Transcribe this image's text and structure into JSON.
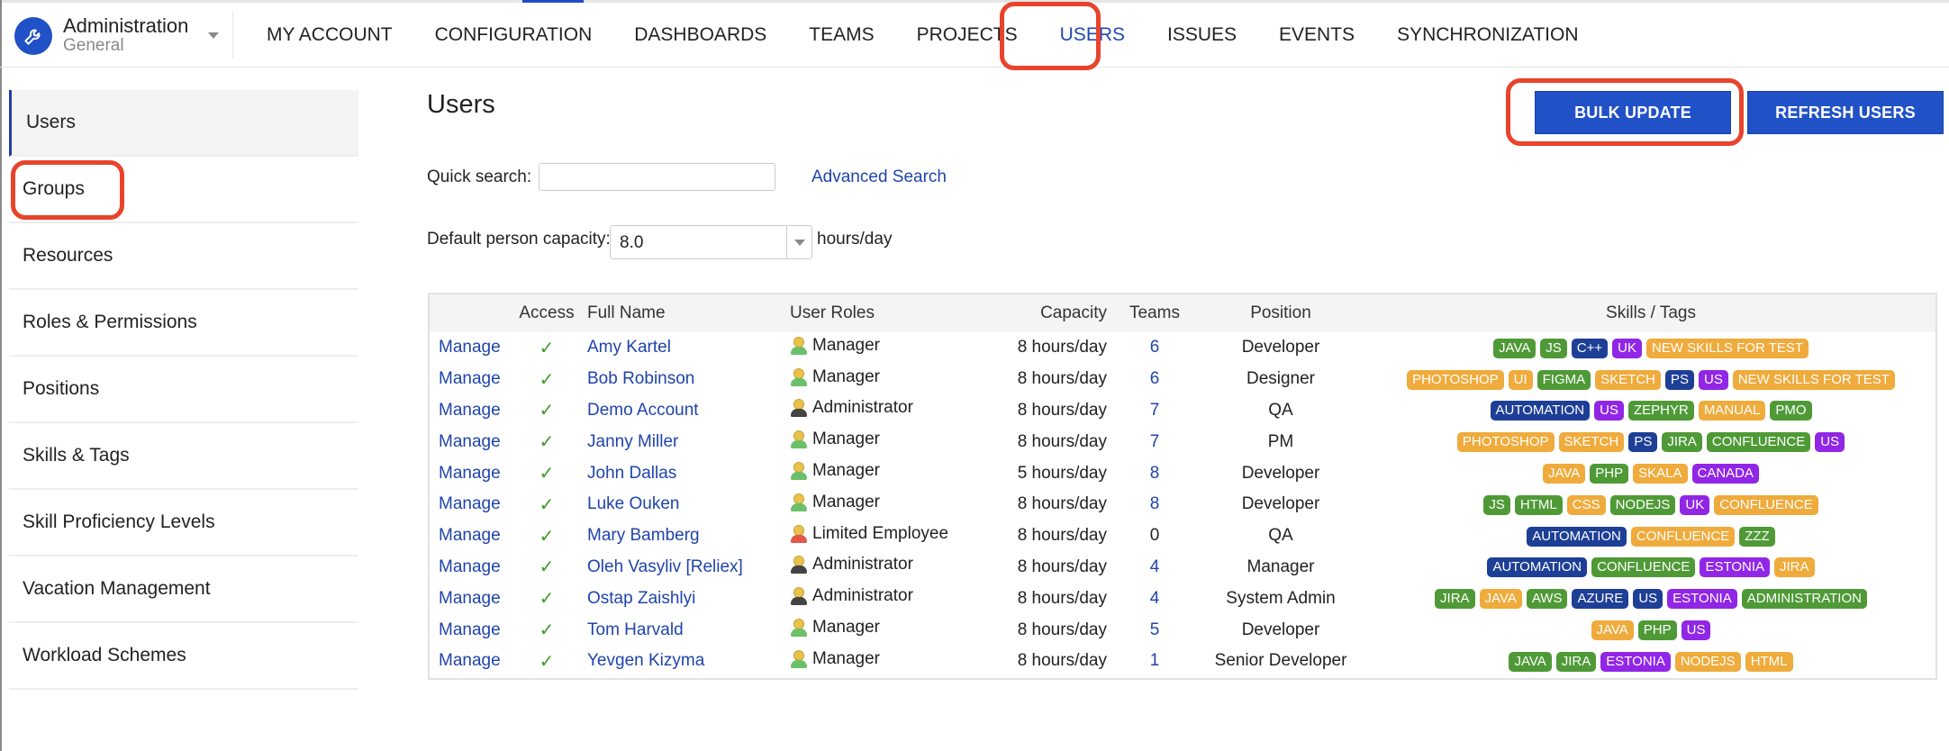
{
  "header": {
    "app_title": "Administration",
    "app_subtitle": "General",
    "nav": [
      {
        "label": "MY ACCOUNT",
        "active": false
      },
      {
        "label": "CONFIGURATION",
        "active": false
      },
      {
        "label": "DASHBOARDS",
        "active": false
      },
      {
        "label": "TEAMS",
        "active": false
      },
      {
        "label": "PROJECTS",
        "active": false
      },
      {
        "label": "USERS",
        "active": true
      },
      {
        "label": "ISSUES",
        "active": false
      },
      {
        "label": "EVENTS",
        "active": false
      },
      {
        "label": "SYNCHRONIZATION",
        "active": false
      }
    ]
  },
  "sidebar": {
    "items": [
      {
        "label": "Users",
        "active": true
      },
      {
        "label": "Groups",
        "active": false
      },
      {
        "label": "Resources",
        "active": false
      },
      {
        "label": "Roles & Permissions",
        "active": false
      },
      {
        "label": "Positions",
        "active": false
      },
      {
        "label": "Skills & Tags",
        "active": false
      },
      {
        "label": "Skill Proficiency Levels",
        "active": false
      },
      {
        "label": "Vacation Management",
        "active": false
      },
      {
        "label": "Workload Schemes",
        "active": false
      }
    ]
  },
  "main": {
    "title": "Users",
    "bulk_update_label": "BULK UPDATE",
    "refresh_users_label": "REFRESH USERS",
    "quick_search_label": "Quick search:",
    "quick_search_value": "",
    "advanced_search_label": "Advanced Search",
    "capacity_label": "Default person capacity:",
    "capacity_value": "8.0",
    "capacity_unit": "hours/day"
  },
  "colors": {
    "accent": "#2151c6",
    "link": "#1f44aa",
    "highlight": "#e8432b",
    "tag_green": "#4f9a37",
    "tag_orange": "#efab3c",
    "tag_navy": "#1e3f96",
    "tag_purple": "#9126e6",
    "role_manager": "#6cc06a",
    "role_admin": "#444444",
    "role_limited": "#e2584a"
  },
  "table": {
    "columns": [
      "",
      "Access",
      "Full Name",
      "User Roles",
      "Capacity",
      "Teams",
      "Position",
      "Skills / Tags"
    ],
    "manage_label": "Manage",
    "access_icon": "✓",
    "rows": [
      {
        "name": "Amy Kartel",
        "role": "Manager",
        "role_type": "manager",
        "capacity": "8 hours/day",
        "teams": "6",
        "position": "Developer",
        "tags": [
          [
            "JAVA",
            "green"
          ],
          [
            "JS",
            "green"
          ],
          [
            "C++",
            "navy"
          ],
          [
            "UK",
            "purple"
          ],
          [
            "NEW SKILLS FOR TEST",
            "orange"
          ]
        ]
      },
      {
        "name": "Bob Robinson",
        "role": "Manager",
        "role_type": "manager",
        "capacity": "8 hours/day",
        "teams": "6",
        "position": "Designer",
        "tags": [
          [
            "PHOTOSHOP",
            "orange"
          ],
          [
            "UI",
            "orange"
          ],
          [
            "FIGMA",
            "green"
          ],
          [
            "SKETCH",
            "orange"
          ],
          [
            "PS",
            "navy"
          ],
          [
            "US",
            "purple"
          ],
          [
            "NEW SKILLS FOR TEST",
            "orange"
          ]
        ]
      },
      {
        "name": "Demo Account",
        "role": "Administrator",
        "role_type": "admin",
        "capacity": "8 hours/day",
        "teams": "7",
        "position": "QA",
        "tags": [
          [
            "AUTOMATION",
            "navy"
          ],
          [
            "US",
            "purple"
          ],
          [
            "ZEPHYR",
            "green"
          ],
          [
            "MANUAL",
            "orange"
          ],
          [
            "PMO",
            "green"
          ]
        ]
      },
      {
        "name": "Janny Miller",
        "role": "Manager",
        "role_type": "manager",
        "capacity": "8 hours/day",
        "teams": "7",
        "position": "PM",
        "tags": [
          [
            "PHOTOSHOP",
            "orange"
          ],
          [
            "SKETCH",
            "orange"
          ],
          [
            "PS",
            "navy"
          ],
          [
            "JIRA",
            "green"
          ],
          [
            "CONFLUENCE",
            "green"
          ],
          [
            "US",
            "purple"
          ]
        ]
      },
      {
        "name": "John Dallas",
        "role": "Manager",
        "role_type": "manager",
        "capacity": "5 hours/day",
        "teams": "8",
        "position": "Developer",
        "tags": [
          [
            "JAVA",
            "orange"
          ],
          [
            "PHP",
            "green"
          ],
          [
            "SKALA",
            "orange"
          ],
          [
            "CANADA",
            "purple"
          ]
        ]
      },
      {
        "name": "Luke Ouken",
        "role": "Manager",
        "role_type": "manager",
        "capacity": "8 hours/day",
        "teams": "8",
        "position": "Developer",
        "tags": [
          [
            "JS",
            "green"
          ],
          [
            "HTML",
            "green"
          ],
          [
            "CSS",
            "orange"
          ],
          [
            "NODEJS",
            "green"
          ],
          [
            "UK",
            "purple"
          ],
          [
            "CONFLUENCE",
            "orange"
          ]
        ]
      },
      {
        "name": "Mary Bamberg",
        "role": "Limited Employee",
        "role_type": "limited",
        "capacity": "8 hours/day",
        "teams": "0",
        "position": "QA",
        "tags": [
          [
            "AUTOMATION",
            "navy"
          ],
          [
            "CONFLUENCE",
            "orange"
          ],
          [
            "ZZZ",
            "green"
          ]
        ]
      },
      {
        "name": "Oleh Vasyliv [Reliex]",
        "role": "Administrator",
        "role_type": "admin",
        "capacity": "8 hours/day",
        "teams": "4",
        "position": "Manager",
        "tags": [
          [
            "AUTOMATION",
            "navy"
          ],
          [
            "CONFLUENCE",
            "green"
          ],
          [
            "ESTONIA",
            "purple"
          ],
          [
            "JIRA",
            "orange"
          ]
        ]
      },
      {
        "name": "Ostap Zaishlyi",
        "role": "Administrator",
        "role_type": "admin",
        "capacity": "8 hours/day",
        "teams": "4",
        "position": "System Admin",
        "tags": [
          [
            "JIRA",
            "green"
          ],
          [
            "JAVA",
            "orange"
          ],
          [
            "AWS",
            "green"
          ],
          [
            "AZURE",
            "navy"
          ],
          [
            "US",
            "navy"
          ],
          [
            "ESTONIA",
            "purple"
          ],
          [
            "ADMINISTRATION",
            "green"
          ]
        ]
      },
      {
        "name": "Tom Harvald",
        "role": "Manager",
        "role_type": "manager",
        "capacity": "8 hours/day",
        "teams": "5",
        "position": "Developer",
        "tags": [
          [
            "JAVA",
            "orange"
          ],
          [
            "PHP",
            "green"
          ],
          [
            "US",
            "purple"
          ]
        ]
      },
      {
        "name": "Yevgen Kizyma",
        "role": "Manager",
        "role_type": "manager",
        "capacity": "8 hours/day",
        "teams": "1",
        "position": "Senior Developer",
        "tags": [
          [
            "JAVA",
            "green"
          ],
          [
            "JIRA",
            "green"
          ],
          [
            "ESTONIA",
            "purple"
          ],
          [
            "NODEJS",
            "orange"
          ],
          [
            "HTML",
            "orange"
          ]
        ]
      }
    ]
  }
}
